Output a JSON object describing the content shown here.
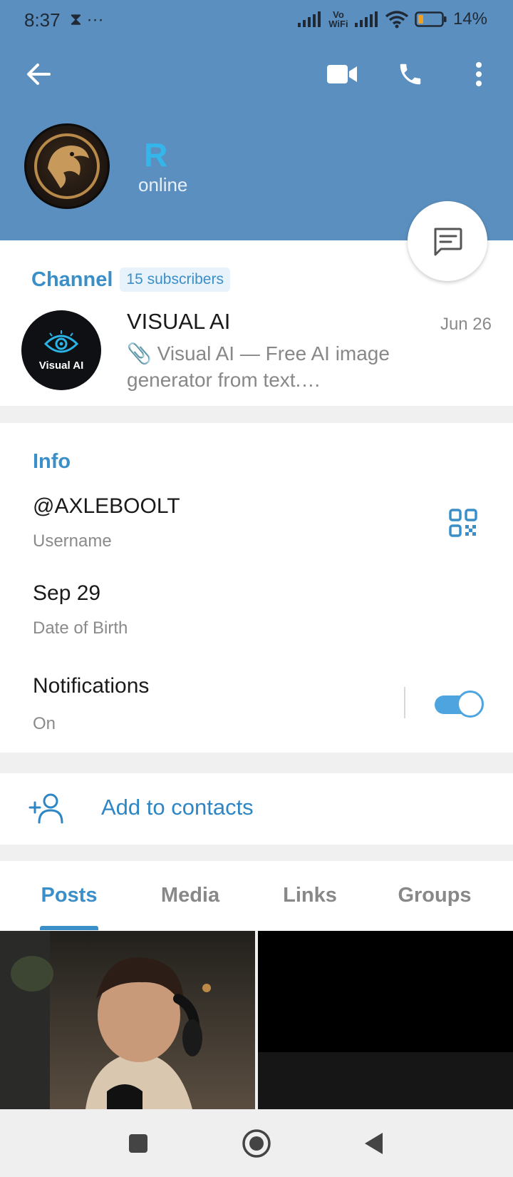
{
  "status_bar": {
    "time": "8:37",
    "left_icons": "⧗ ···",
    "network_label": "Vo WiFi",
    "battery_percent": "14%"
  },
  "toolbar": {
    "back_icon": "arrow-left-icon",
    "video_icon": "video-camera-icon",
    "call_icon": "phone-icon",
    "more_icon": "vertical-dots-icon"
  },
  "profile": {
    "name": "R",
    "status": "online",
    "avatar_icon": "dragon-logo-icon"
  },
  "channel": {
    "label": "Channel",
    "subscribers": "15 subscribers",
    "title": "VISUAL AI",
    "date": "Jun 26",
    "preview": "📎 Visual AI — Free AI image generator from text.…",
    "avatar_label": "Visual AI"
  },
  "info": {
    "title": "Info",
    "username": "@AXLEBOOLT",
    "username_label": "Username",
    "dob": "Sep 29",
    "dob_label": "Date of Birth",
    "notifications": "Notifications",
    "notifications_state": "On",
    "notifications_enabled": true
  },
  "contacts": {
    "label": "Add to contacts"
  },
  "tabs": {
    "items": [
      "Posts",
      "Media",
      "Links",
      "Groups"
    ],
    "active": "Posts"
  },
  "colors": {
    "header": "#5b8fbf",
    "accent": "#3a8fc9",
    "name": "#35b6ea"
  }
}
